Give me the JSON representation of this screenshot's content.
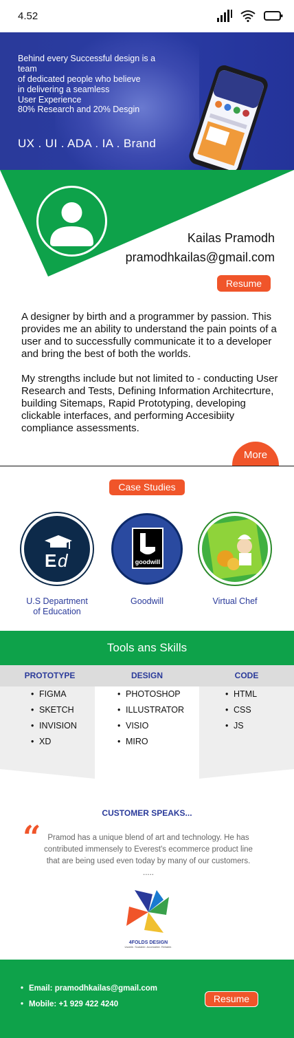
{
  "status_bar": {
    "time": "4.52",
    "icons": [
      "signal-icon",
      "wifi-icon",
      "battery-icon"
    ]
  },
  "hero": {
    "tagline_lines": [
      "Behind every Successful design is a team",
      "of dedicated people who believe",
      "in delivering a seamless",
      "User Experience"
    ],
    "ratio_text": "80% Research and 20% Desgin",
    "areas": "UX . UI .  ADA .  IA . Brand"
  },
  "profile": {
    "name": "Kailas Pramodh",
    "email": "pramodhkailas@gmail.com",
    "resume_label": "Resume",
    "avatar_icon": "user-avatar-icon"
  },
  "bio": {
    "paragraph1": "A designer by  birth and a programmer by passion. This provides me an ability to understand the pain points of a user and to successfully communicate it to a developer and bring the best of both the worlds.",
    "paragraph2": "My strengths include but not limited to -  conducting User Research and Tests,  Defining  Information Architecrture,  building Sitemaps,  Rapid Prototyping,  developing clickable interfaces, and performing Accesibiity compliance assessments.",
    "more_label": "More"
  },
  "case_studies": {
    "button_label": "Case Studies",
    "items": [
      {
        "label_line1": "U.S Department",
        "label_line2": "of Education",
        "badge_text": ""
      },
      {
        "label_line1": "Goodwill",
        "label_line2": "",
        "badge_text": "goodwill"
      },
      {
        "label_line1": "Virtual Chef",
        "label_line2": "",
        "badge_text": ""
      }
    ]
  },
  "tools": {
    "title": "Tools ans Skills",
    "columns": [
      {
        "header": "PROTOTYPE",
        "items": [
          "FIGMA",
          "SKETCH",
          "INVISION",
          "XD"
        ]
      },
      {
        "header": "DESIGN",
        "items": [
          "PHOTOSHOP",
          "ILLUSTRATOR",
          "VISIO",
          "MIRO"
        ]
      },
      {
        "header": "CODE",
        "items": [
          "HTML",
          "CSS",
          "JS"
        ]
      }
    ]
  },
  "testimonial": {
    "title": "CUSTOMER SPEAKS...",
    "quote_mark": "“",
    "text": "Pramod has a unique blend of art and technology. He has contributed immensely to Everest's ecommerce product line that are being used even today by many of our customers. .....",
    "logo_name": "4FOLDS DESIGN",
    "logo_tagline": "Usable. Scalable. Accessible. Reliable."
  },
  "footer": {
    "email_text": "Email: pramodhkailas@gmail.com",
    "mobile_text": "Mobile: +1 929 422 4240",
    "resume_label": "Resume"
  },
  "colors": {
    "primary_blue": "#2a3a9a",
    "green": "#0ea24a",
    "orange": "#f0552a",
    "grey": "#dcdcdc"
  }
}
